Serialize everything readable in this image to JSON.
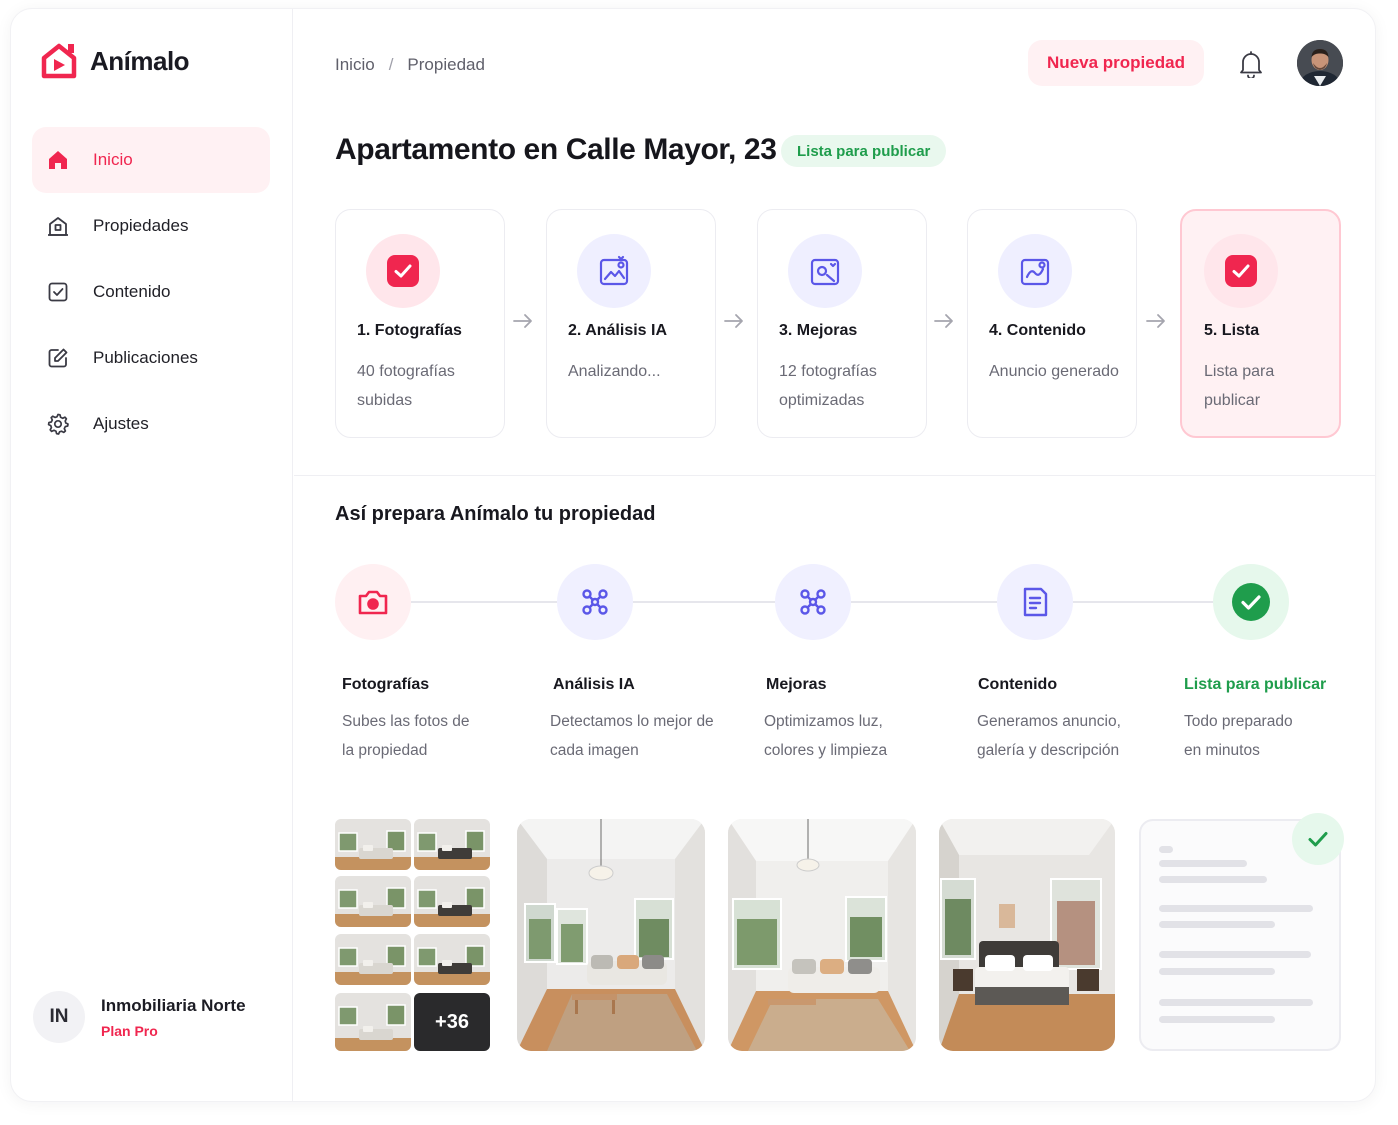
{
  "brand": {
    "name": "Animalo_display",
    "display": "Anímalo",
    "accent": "#f0264f",
    "success": "#1f9d4c",
    "ai": "#5b57e8"
  },
  "sidebar": {
    "items": [
      {
        "label": "Inicio",
        "icon": "home-icon",
        "active": true
      },
      {
        "label": "Propiedades",
        "icon": "building-icon",
        "active": false
      },
      {
        "label": "Contenido",
        "icon": "checkbox-icon",
        "active": false
      },
      {
        "label": "Publicaciones",
        "icon": "edit-icon",
        "active": false
      },
      {
        "label": "Ajustes",
        "icon": "gear-icon",
        "active": false
      }
    ],
    "account": {
      "initials": "IN",
      "name": "Inmobiliaria Norte",
      "plan": "Plan Pro"
    }
  },
  "header": {
    "breadcrumb": [
      "Inicio",
      "/",
      "Propiedad"
    ],
    "new_button": "Nueva propiedad"
  },
  "property": {
    "title": "Apartamento en Calle Mayor, 23",
    "status": "Lista para publicar"
  },
  "steps": [
    {
      "title": "1. Fotografías",
      "desc": "40 fotografías subidas",
      "icon": "check-square-icon"
    },
    {
      "title": "2. Análisis IA",
      "desc": "Analizando...",
      "icon": "image-ai-icon"
    },
    {
      "title": "3. Mejoras",
      "desc": "12 fotografías optimizadas",
      "icon": "image-enhance-icon"
    },
    {
      "title": "4. Contenido",
      "desc": "Anuncio generado",
      "icon": "image-content-icon"
    },
    {
      "title": "5. Lista",
      "desc": "Lista para publicar",
      "icon": "check-square-icon"
    }
  ],
  "process": {
    "title": "Así prepara Anímalo tu propiedad",
    "stages": [
      {
        "title": "Fotografías",
        "desc": "Subes las fotos de la propiedad",
        "icon": "camera-icon"
      },
      {
        "title": "Análisis IA",
        "desc": "Detectamos lo mejor de cada imagen",
        "icon": "ai-network-icon"
      },
      {
        "title": "Mejoras",
        "desc": "Optimizamos luz, colores y limpieza",
        "icon": "ai-network-icon"
      },
      {
        "title": "Contenido",
        "desc": "Generamos anuncio, galería y descripción",
        "icon": "document-icon"
      },
      {
        "title": "Lista para publicar",
        "desc": "Todo preparado en minutos",
        "icon": "check-circle-icon"
      }
    ]
  },
  "gallery": {
    "more_count": "+36"
  }
}
